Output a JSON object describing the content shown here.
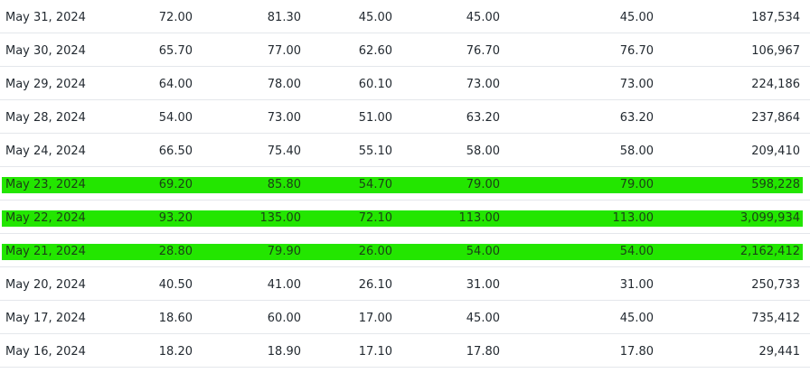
{
  "history": {
    "highlight_color": "#23e600",
    "rows": [
      {
        "date": "May 31, 2024",
        "open": "72.00",
        "high": "81.30",
        "low": "45.00",
        "close": "45.00",
        "adj_close": "45.00",
        "volume": "187,534",
        "highlighted": false
      },
      {
        "date": "May 30, 2024",
        "open": "65.70",
        "high": "77.00",
        "low": "62.60",
        "close": "76.70",
        "adj_close": "76.70",
        "volume": "106,967",
        "highlighted": false
      },
      {
        "date": "May 29, 2024",
        "open": "64.00",
        "high": "78.00",
        "low": "60.10",
        "close": "73.00",
        "adj_close": "73.00",
        "volume": "224,186",
        "highlighted": false
      },
      {
        "date": "May 28, 2024",
        "open": "54.00",
        "high": "73.00",
        "low": "51.00",
        "close": "63.20",
        "adj_close": "63.20",
        "volume": "237,864",
        "highlighted": false
      },
      {
        "date": "May 24, 2024",
        "open": "66.50",
        "high": "75.40",
        "low": "55.10",
        "close": "58.00",
        "adj_close": "58.00",
        "volume": "209,410",
        "highlighted": false
      },
      {
        "date": "May 23, 2024",
        "open": "69.20",
        "high": "85.80",
        "low": "54.70",
        "close": "79.00",
        "adj_close": "79.00",
        "volume": "598,228",
        "highlighted": true
      },
      {
        "date": "May 22, 2024",
        "open": "93.20",
        "high": "135.00",
        "low": "72.10",
        "close": "113.00",
        "adj_close": "113.00",
        "volume": "3,099,934",
        "highlighted": true
      },
      {
        "date": "May 21, 2024",
        "open": "28.80",
        "high": "79.90",
        "low": "26.00",
        "close": "54.00",
        "adj_close": "54.00",
        "volume": "2,162,412",
        "highlighted": true
      },
      {
        "date": "May 20, 2024",
        "open": "40.50",
        "high": "41.00",
        "low": "26.10",
        "close": "31.00",
        "adj_close": "31.00",
        "volume": "250,733",
        "highlighted": false
      },
      {
        "date": "May 17, 2024",
        "open": "18.60",
        "high": "60.00",
        "low": "17.00",
        "close": "45.00",
        "adj_close": "45.00",
        "volume": "735,412",
        "highlighted": false
      },
      {
        "date": "May 16, 2024",
        "open": "18.20",
        "high": "18.90",
        "low": "17.10",
        "close": "17.80",
        "adj_close": "17.80",
        "volume": "29,441",
        "highlighted": false
      }
    ]
  }
}
